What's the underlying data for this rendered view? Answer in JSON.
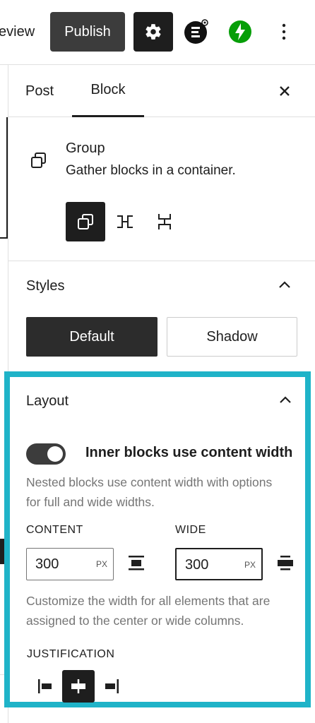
{
  "topbar": {
    "preview_label": "eview",
    "publish_label": "Publish",
    "settings_icon": "gear-icon",
    "plugin_one_icon": "editorial-plugin-icon",
    "plugin_two_icon": "jetpack-bolt-icon",
    "more_icon": "vertical-ellipsis-icon"
  },
  "sidebar": {
    "tabs": [
      {
        "label": "Post"
      },
      {
        "label": "Block"
      }
    ],
    "active_tab": "Block",
    "block": {
      "title": "Group",
      "description": "Gather blocks in a container.",
      "variations": [
        "Group",
        "Row",
        "Stack"
      ],
      "active_variation": "Group"
    },
    "styles": {
      "title": "Styles",
      "options": [
        "Default",
        "Shadow"
      ],
      "selected": "Default"
    },
    "layout": {
      "title": "Layout",
      "toggle_label": "Inner blocks use content width",
      "toggle_on": true,
      "toggle_help": "Nested blocks use content width with options for full and wide widths.",
      "content_label": "CONTENT",
      "content_value": "300",
      "content_unit": "PX",
      "wide_label": "WIDE",
      "wide_value": "300",
      "wide_unit": "PX",
      "width_help": "Customize the width for all elements that are assigned to the center or wide columns."
    },
    "justification": {
      "label": "JUSTIFICATION",
      "options": [
        "left",
        "center",
        "right"
      ],
      "selected": "center"
    }
  },
  "colors": {
    "highlight": "#1fb3c8",
    "dark": "#1e1e1e",
    "jetpack_green": "#069e08"
  }
}
